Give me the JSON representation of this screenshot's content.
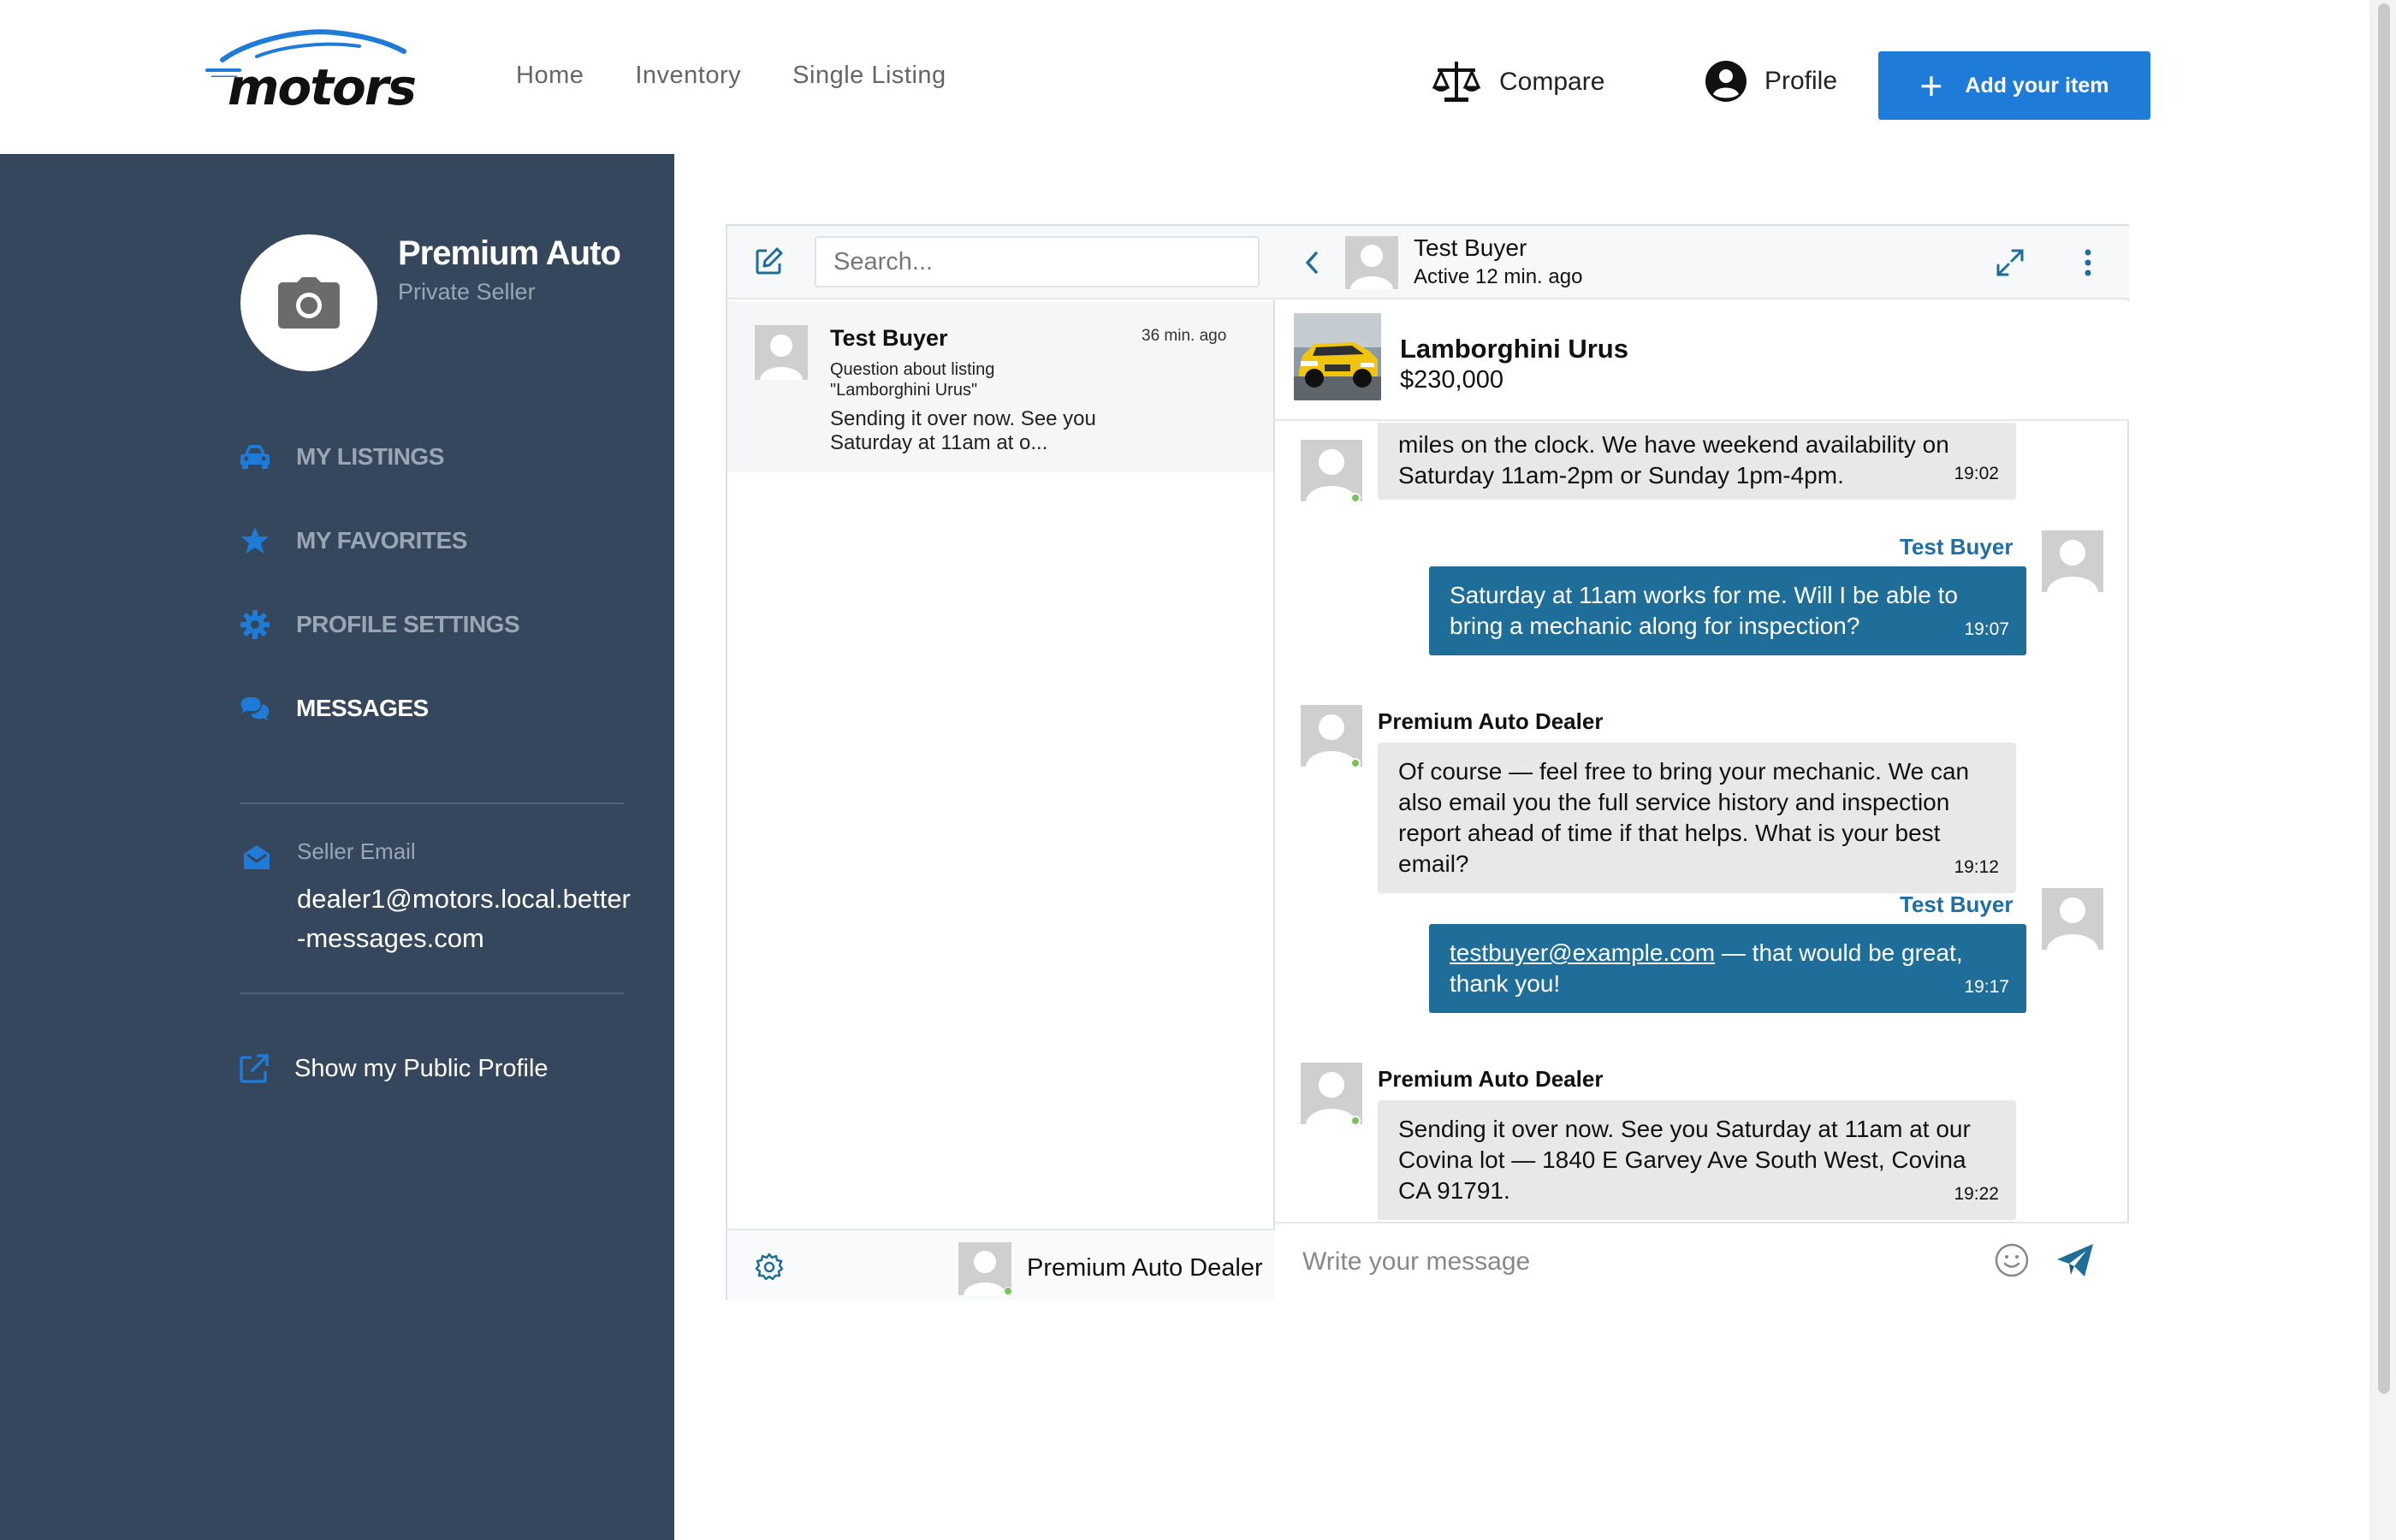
{
  "header": {
    "logo_text": "motors",
    "nav": [
      "Home",
      "Inventory",
      "Single Listing"
    ],
    "compare_label": "Compare",
    "profile_label": "Profile",
    "add_item_label": "Add your item"
  },
  "sidebar": {
    "seller_name": "Premium Auto",
    "seller_type": "Private Seller",
    "menu": [
      {
        "label": "MY LISTINGS",
        "icon": "car-icon",
        "active": false
      },
      {
        "label": "MY FAVORITES",
        "icon": "star-icon",
        "active": false
      },
      {
        "label": "PROFILE SETTINGS",
        "icon": "gear-icon",
        "active": false
      },
      {
        "label": "MESSAGES",
        "icon": "chat-bubbles-icon",
        "active": true
      }
    ],
    "email_label": "Seller Email",
    "email_value": "dealer1@motors.local.better-messages.com",
    "public_profile_label": "Show my Public Profile"
  },
  "chat": {
    "search_placeholder": "Search...",
    "threads": [
      {
        "name": "Test Buyer",
        "time": "36 min. ago",
        "subject": "Question about listing \"Lamborghini Urus\"",
        "snippet": "Sending it over now. See you Saturday at 11am at o..."
      }
    ],
    "current_user": "Premium Auto Dealer",
    "peer": {
      "name": "Test Buyer",
      "status": "Active 12 min. ago"
    },
    "listing": {
      "title": "Lamborghini Urus",
      "price": "$230,000"
    },
    "messages": [
      {
        "sender": "",
        "side": "in",
        "text": "miles on the clock. We have weekend availability on Saturday 11am-2pm or Sunday 1pm-4pm.",
        "time": "19:02"
      },
      {
        "sender": "Test Buyer",
        "side": "out",
        "text": "Saturday at 11am works for me. Will I be able to bring a mechanic along for inspection?",
        "time": "19:07"
      },
      {
        "sender": "Premium Auto Dealer",
        "side": "in",
        "text": "Of course — feel free to bring your mechanic. We can also email you the full service history and inspection report ahead of time if that helps. What is your best email?",
        "time": "19:12"
      },
      {
        "sender": "Test Buyer",
        "side": "out",
        "link": "testbuyer@example.com",
        "text": " — that would be great, thank you!",
        "time": "19:17"
      },
      {
        "sender": "Premium Auto Dealer",
        "side": "in",
        "text": "Sending it over now. See you Saturday at 11am at our Covina lot — 1840 E Garvey Ave South West, Covina CA 91791.",
        "time": "19:22"
      }
    ],
    "compose_placeholder": "Write your message"
  },
  "colors": {
    "accent": "#1e7bd8",
    "sidebar_bg": "#35475c",
    "outgoing_bubble": "#1f6e9a",
    "incoming_bubble": "#e8e8e8",
    "buyer_name": "#1e6fa6",
    "online": "#7ac35a"
  }
}
